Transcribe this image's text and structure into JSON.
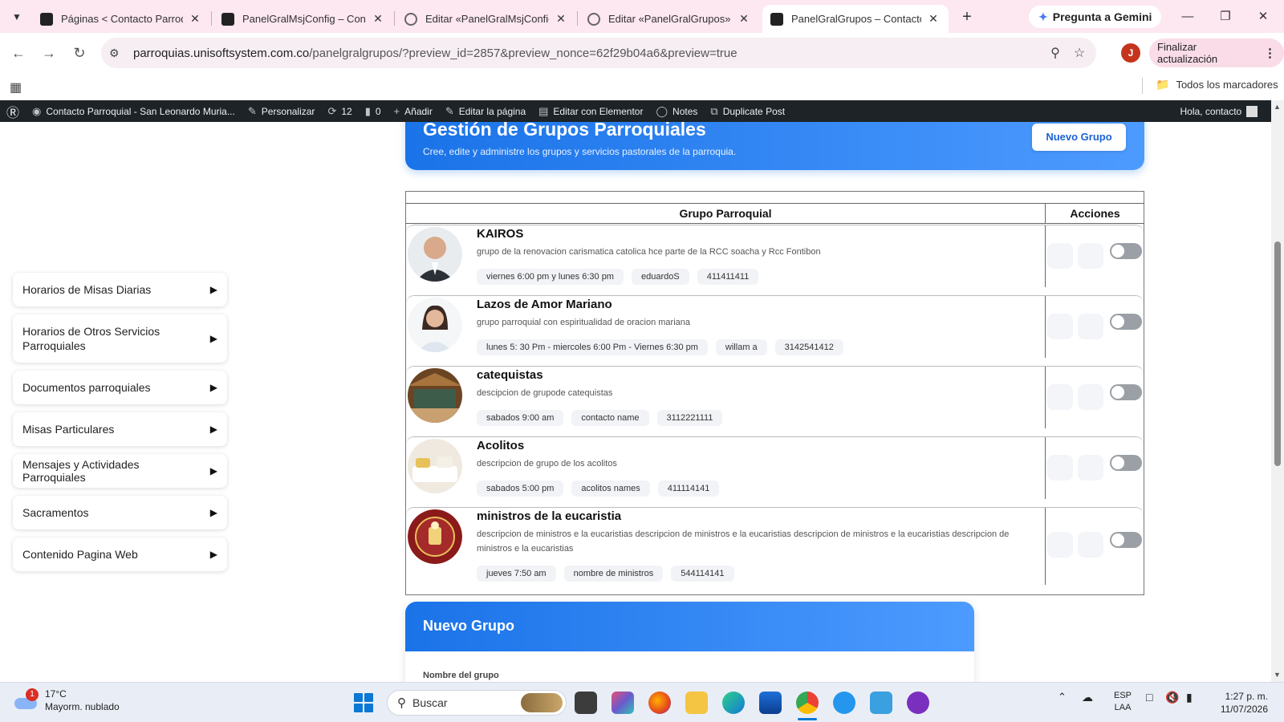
{
  "browser": {
    "tabs": [
      {
        "label": "Páginas < Contacto Parroquial",
        "icon": "site-favicon",
        "active": false
      },
      {
        "label": "PanelGralMsjConfig – Contacto",
        "icon": "site-favicon",
        "active": false
      },
      {
        "label": "Editar «PanelGralMsjConfig»",
        "icon": "globe-icon",
        "active": false
      },
      {
        "label": "Editar «PanelGralGrupos» con",
        "icon": "globe-icon",
        "active": false
      },
      {
        "label": "PanelGralGrupos – Contacto",
        "icon": "site-favicon",
        "active": true
      }
    ],
    "gemini_label": "Pregunta a Gemini",
    "url_host": "parroquias.unisoftsystem.com.co",
    "url_path": "/panelgralgrupos/?preview_id=2857&preview_nonce=62f29b04a6&preview=true",
    "profile_initial": "J",
    "update_label": "Finalizar actualización",
    "all_bookmarks": "Todos los marcadores"
  },
  "adminbar": {
    "site_name": "Contacto Parroquial - San Leonardo Muria...",
    "customize": "Personalizar",
    "updates_count": "12",
    "comments_count": "0",
    "add_new": "Añadir",
    "edit_page": "Editar la página",
    "edit_elementor": "Editar con Elementor",
    "notes": "Notes",
    "duplicate": "Duplicate Post",
    "greeting": "Hola, contacto"
  },
  "sidebar": {
    "items": [
      {
        "label": "Horarios de Misas Diarias"
      },
      {
        "label": "Horarios de Otros Servicios Parroquiales"
      },
      {
        "label": "Documentos parroquiales"
      },
      {
        "label": "Misas Particulares"
      },
      {
        "label": "Mensajes y Actividades Parroquiales"
      },
      {
        "label": "Sacramentos"
      },
      {
        "label": "Contenido Pagina Web"
      }
    ]
  },
  "header": {
    "title": "Gestión de Grupos Parroquiales",
    "subtitle": "Cree, edite y administre los grupos y servicios pastorales de la parroquia.",
    "new_group_button": "Nuevo Grupo"
  },
  "table": {
    "col_group": "Grupo Parroquial",
    "col_actions": "Acciones",
    "rows": [
      {
        "name": "KAIROS",
        "description": "grupo de la renovacion carismatica catolica hce parte de la RCC soacha y Rcc Fontibon",
        "schedule": "viernes 6:00 pm y lunes 6:30 pm",
        "contact": "eduardoS",
        "phone": "411411411",
        "thumb_color": "#6d7480",
        "active": false
      },
      {
        "name": "Lazos de Amor Mariano",
        "description": "grupo parroquial con espiritualidad de oracion mariana",
        "schedule": "lunes 5: 30 Pm - miercoles 6:00 Pm - Viernes 6:30 pm",
        "contact": "willam a",
        "phone": "3142541412",
        "thumb_color": "#9aa6b4",
        "active": false
      },
      {
        "name": "catequistas",
        "description": "descipcion de grupode catequistas",
        "schedule": "sabados 9:00 am",
        "contact": "contacto name",
        "phone": "3112221111",
        "thumb_color": "#8a5a2b",
        "active": false
      },
      {
        "name": "Acolitos",
        "description": "descripcion de grupo de los acolitos",
        "schedule": "sabados 5:00 pm",
        "contact": "acolitos names",
        "phone": "411114141",
        "thumb_color": "#d9cbb3",
        "active": false
      },
      {
        "name": "ministros de la eucaristia",
        "description": "descripcion de ministros e la eucaristias descripcion de ministros e la eucaristias descripcion de ministros e la eucaristias descripcion de ministros e la eucaristias",
        "schedule": "jueves 7:50 am",
        "contact": "nombre de ministros",
        "phone": "544114141",
        "thumb_color": "#8b1a1a",
        "active": false
      }
    ]
  },
  "form": {
    "title": "Nuevo Grupo",
    "name_label": "Nombre del grupo"
  },
  "taskbar": {
    "weather_badge": "1",
    "temperature": "17°C",
    "weather_desc": "Mayorm. nublado",
    "search_placeholder": "Buscar",
    "lang_1": "ESP",
    "lang_2": "LAA",
    "time": "1:27 p. m.",
    "date": "11/07/2026"
  },
  "colors": {
    "accent": "#1a73e8",
    "tabstrip": "#fde7f0",
    "adminbar": "#1d2327"
  }
}
